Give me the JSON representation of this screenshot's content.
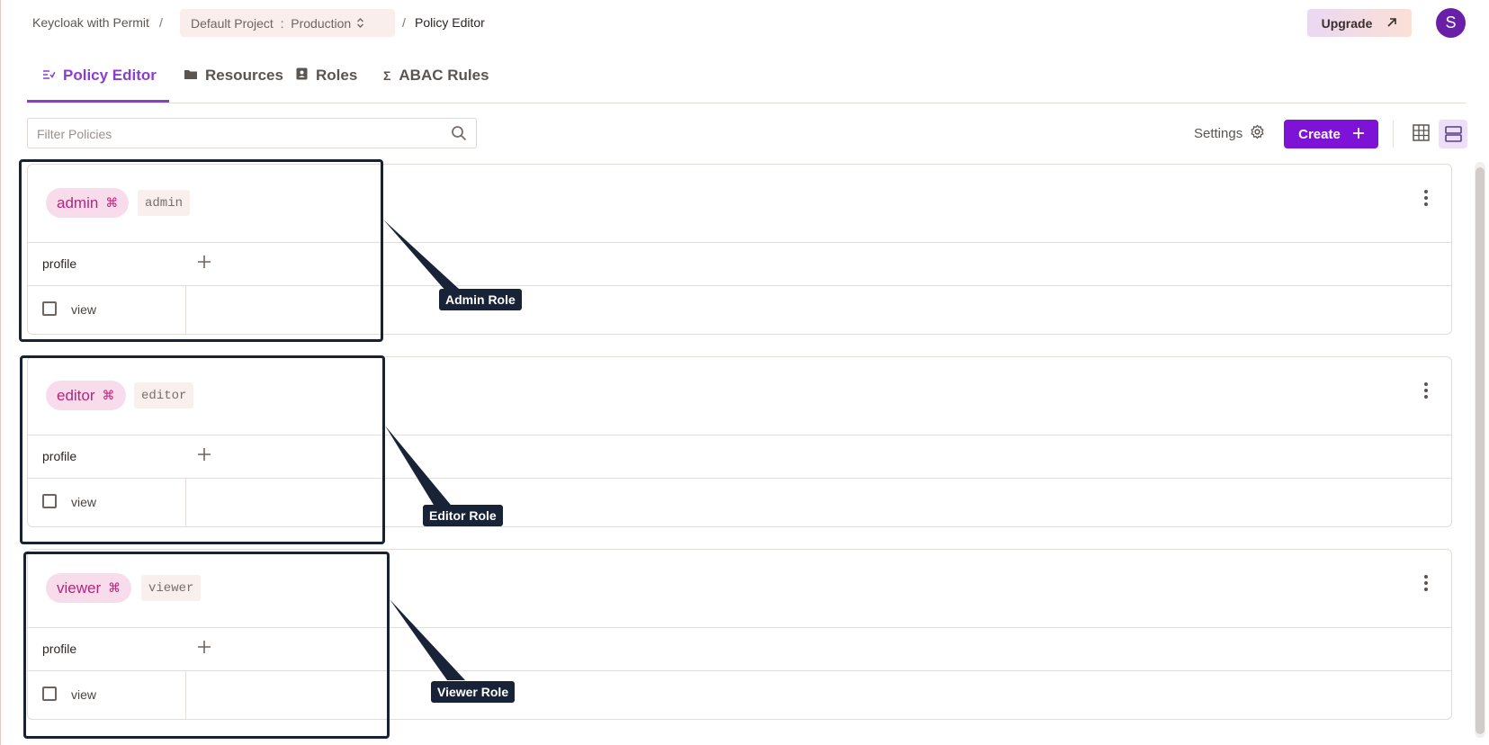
{
  "breadcrumb": {
    "app": "Keycloak with Permit",
    "sep1": "/",
    "project": "Default Project  :  Production",
    "sep2": "/",
    "current": "Policy Editor"
  },
  "header": {
    "upgrade_label": "Upgrade",
    "avatar_initial": "S"
  },
  "tabs": [
    {
      "label": "Policy Editor",
      "active": true
    },
    {
      "label": "Resources"
    },
    {
      "label": "Roles"
    },
    {
      "label": "ABAC Rules"
    }
  ],
  "toolbar": {
    "filter_placeholder": "Filter Policies",
    "settings_label": "Settings",
    "create_label": "Create"
  },
  "roles": [
    {
      "name": "admin",
      "key": "admin",
      "resource": "profile",
      "action": "view",
      "checked": false
    },
    {
      "name": "editor",
      "key": "editor",
      "resource": "profile",
      "action": "view",
      "checked": false
    },
    {
      "name": "viewer",
      "key": "viewer",
      "resource": "profile",
      "action": "view",
      "checked": false
    }
  ],
  "annotations": [
    {
      "label": "Admin Role"
    },
    {
      "label": "Editor Role"
    },
    {
      "label": "Viewer Role"
    }
  ],
  "colors": {
    "accent": "#8a3fcc",
    "primary_button": "#7e13d8",
    "role_pill_bg": "#f9dcec",
    "role_pill_text": "#b3277a",
    "annotation": "#182338"
  }
}
